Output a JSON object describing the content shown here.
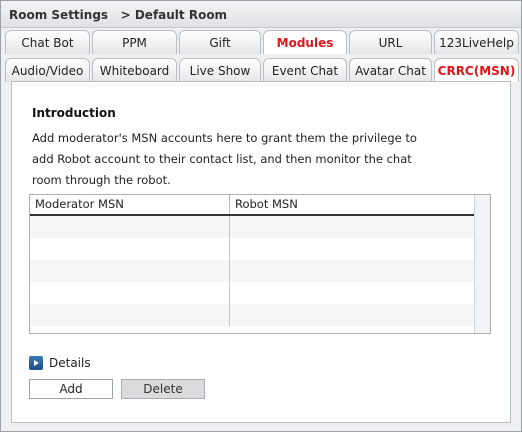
{
  "header": {
    "title": "Room Settings",
    "breadcrumb": "> Default Room"
  },
  "tabs_row1": [
    "Chat Bot",
    "PPM",
    "Gift",
    "Modules",
    "URL",
    "123LiveHelp"
  ],
  "tabs_row2": [
    "Audio/Video",
    "Whiteboard",
    "Live Show",
    "Event Chat",
    "Avatar Chat",
    "CRRC(MSN)"
  ],
  "active_tab": "CRRC(MSN)",
  "highlighted_tab": "Modules",
  "intro": {
    "title": "Introduction",
    "text": "Add moderator's MSN accounts here to grant them the privilege to add Robot account to their contact list, and then monitor the chat room through the robot."
  },
  "grid": {
    "columns": [
      "Moderator MSN",
      "Robot MSN"
    ],
    "rows": [
      [
        "",
        ""
      ],
      [
        "",
        ""
      ],
      [
        "",
        ""
      ],
      [
        "",
        ""
      ],
      [
        "",
        ""
      ]
    ]
  },
  "details": {
    "label": "Details",
    "icon": "play-right-icon"
  },
  "buttons": {
    "add": "Add",
    "delete": "Delete"
  },
  "colors": {
    "active_tab_text": "#e0151a",
    "details_icon": "#2a64a0"
  }
}
